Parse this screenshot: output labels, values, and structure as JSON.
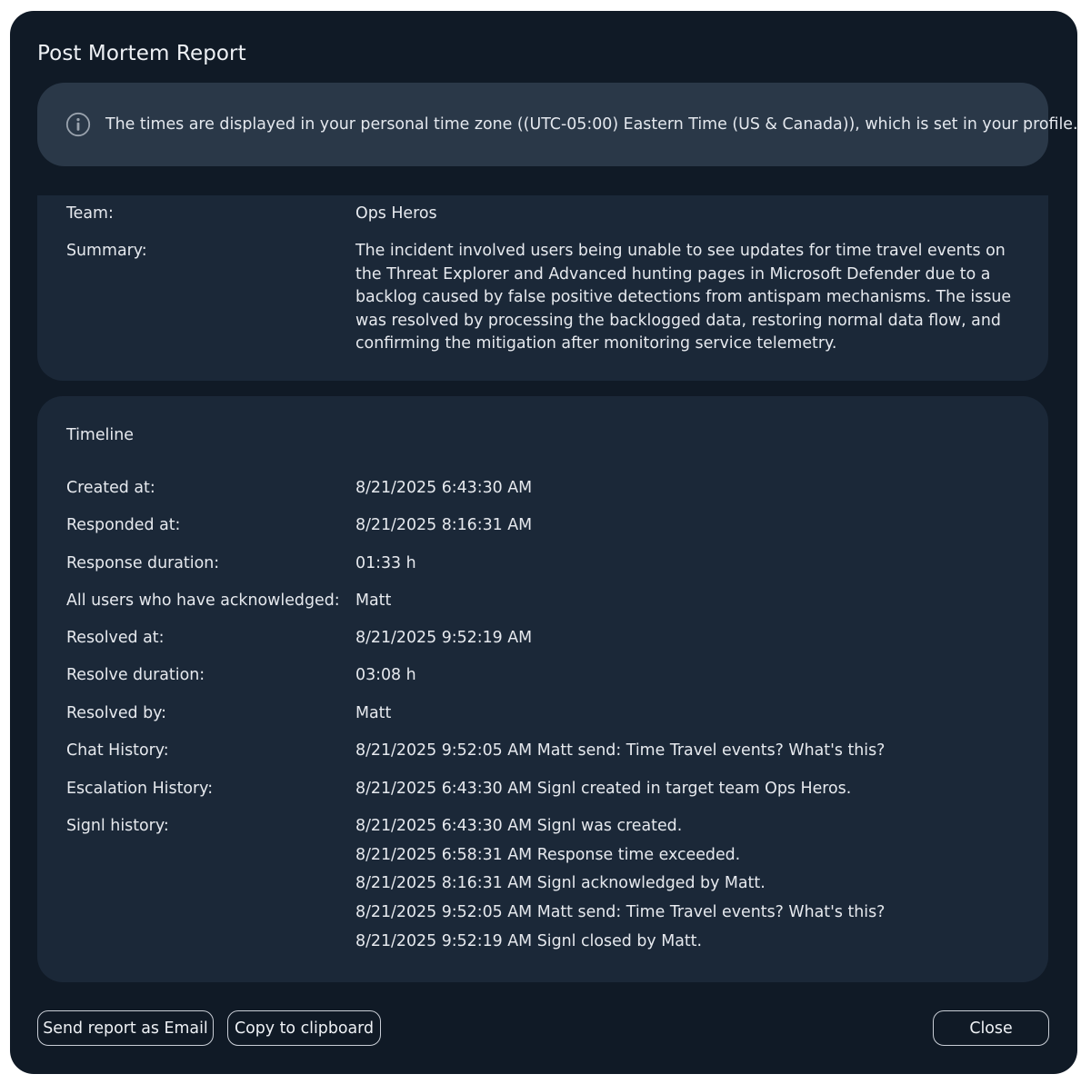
{
  "dialog": {
    "title": "Post Mortem Report"
  },
  "banner": {
    "icon": "info-icon",
    "text": "The times are displayed in your personal time zone ((UTC-05:00) Eastern Time (US & Canada)), which is set in your profile."
  },
  "details": {
    "team_label": "Team:",
    "team_value": "Ops Heros",
    "summary_label": "Summary:",
    "summary_value": "The incident involved users being unable to see updates for time travel events on the Threat Explorer and Advanced hunting pages in Microsoft Defender due to a backlog caused by false positive detections from antispam mechanisms. The issue was resolved by processing the backlogged data, restoring normal data flow, and confirming the mitigation after monitoring service telemetry."
  },
  "timeline": {
    "title": "Timeline",
    "created_label": "Created at:",
    "created_value": "8/21/2025 6:43:30 AM",
    "responded_label": "Responded at:",
    "responded_value": "8/21/2025 8:16:31 AM",
    "response_duration_label": "Response duration:",
    "response_duration_value": "01:33 h",
    "acknowledged_label": "All users who have acknowledged:",
    "acknowledged_value": "Matt",
    "resolved_label": "Resolved at:",
    "resolved_value": "8/21/2025 9:52:19 AM",
    "resolve_duration_label": "Resolve duration:",
    "resolve_duration_value": "03:08 h",
    "resolved_by_label": "Resolved by:",
    "resolved_by_value": "Matt",
    "chat_label": "Chat History:",
    "chat_value": "8/21/2025 9:52:05 AM Matt send: Time Travel events? What's this?",
    "escalation_label": "Escalation History:",
    "escalation_value": "8/21/2025 6:43:30 AM Signl created in target team Ops Heros.",
    "signl_label": "Signl history:",
    "signl_history": [
      "8/21/2025 6:43:30 AM Signl was created.",
      "8/21/2025 6:58:31 AM Response time exceeded.",
      "8/21/2025 8:16:31 AM Signl acknowledged by Matt.",
      "8/21/2025 9:52:05 AM Matt send: Time Travel events? What's this?",
      "8/21/2025 9:52:19 AM Signl closed by Matt."
    ]
  },
  "footer": {
    "email_label": "Send report as Email",
    "copy_label": "Copy to clipboard",
    "close_label": "Close"
  },
  "colors": {
    "dialog_bg": "#101a26",
    "panel_bg": "#1b2838",
    "banner_bg": "#2a3848",
    "text": "#e6e9ee"
  }
}
